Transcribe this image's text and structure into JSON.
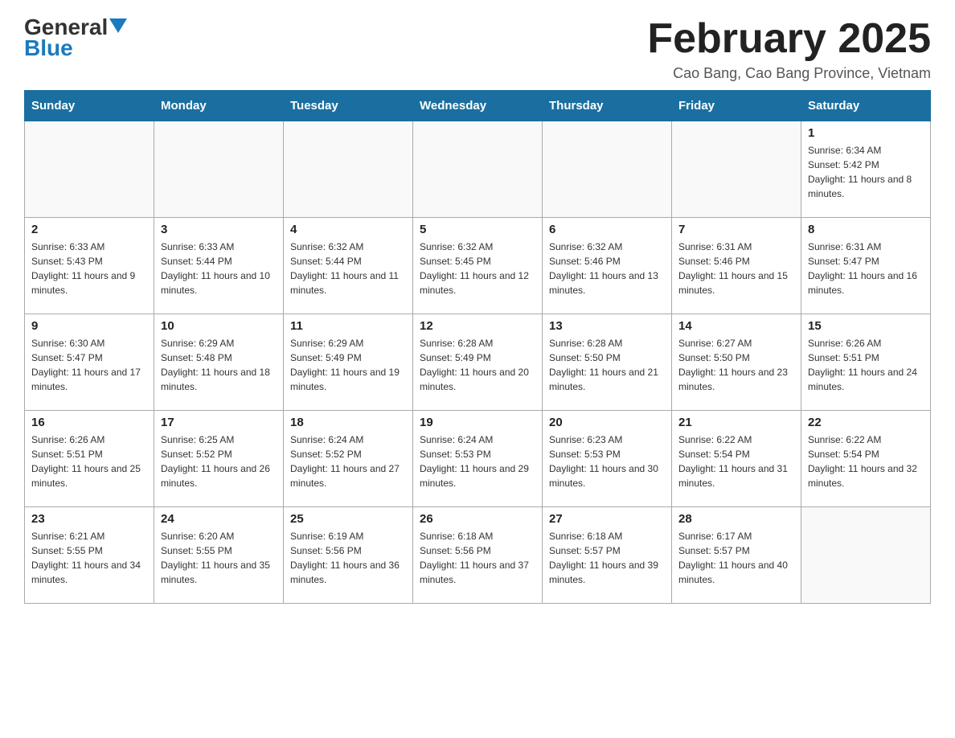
{
  "header": {
    "logo_main": "General",
    "logo_sub": "Blue",
    "title": "February 2025",
    "subtitle": "Cao Bang, Cao Bang Province, Vietnam"
  },
  "days_of_week": [
    "Sunday",
    "Monday",
    "Tuesday",
    "Wednesday",
    "Thursday",
    "Friday",
    "Saturday"
  ],
  "weeks": [
    [
      {
        "day": "",
        "info": ""
      },
      {
        "day": "",
        "info": ""
      },
      {
        "day": "",
        "info": ""
      },
      {
        "day": "",
        "info": ""
      },
      {
        "day": "",
        "info": ""
      },
      {
        "day": "",
        "info": ""
      },
      {
        "day": "1",
        "info": "Sunrise: 6:34 AM\nSunset: 5:42 PM\nDaylight: 11 hours and 8 minutes."
      }
    ],
    [
      {
        "day": "2",
        "info": "Sunrise: 6:33 AM\nSunset: 5:43 PM\nDaylight: 11 hours and 9 minutes."
      },
      {
        "day": "3",
        "info": "Sunrise: 6:33 AM\nSunset: 5:44 PM\nDaylight: 11 hours and 10 minutes."
      },
      {
        "day": "4",
        "info": "Sunrise: 6:32 AM\nSunset: 5:44 PM\nDaylight: 11 hours and 11 minutes."
      },
      {
        "day": "5",
        "info": "Sunrise: 6:32 AM\nSunset: 5:45 PM\nDaylight: 11 hours and 12 minutes."
      },
      {
        "day": "6",
        "info": "Sunrise: 6:32 AM\nSunset: 5:46 PM\nDaylight: 11 hours and 13 minutes."
      },
      {
        "day": "7",
        "info": "Sunrise: 6:31 AM\nSunset: 5:46 PM\nDaylight: 11 hours and 15 minutes."
      },
      {
        "day": "8",
        "info": "Sunrise: 6:31 AM\nSunset: 5:47 PM\nDaylight: 11 hours and 16 minutes."
      }
    ],
    [
      {
        "day": "9",
        "info": "Sunrise: 6:30 AM\nSunset: 5:47 PM\nDaylight: 11 hours and 17 minutes."
      },
      {
        "day": "10",
        "info": "Sunrise: 6:29 AM\nSunset: 5:48 PM\nDaylight: 11 hours and 18 minutes."
      },
      {
        "day": "11",
        "info": "Sunrise: 6:29 AM\nSunset: 5:49 PM\nDaylight: 11 hours and 19 minutes."
      },
      {
        "day": "12",
        "info": "Sunrise: 6:28 AM\nSunset: 5:49 PM\nDaylight: 11 hours and 20 minutes."
      },
      {
        "day": "13",
        "info": "Sunrise: 6:28 AM\nSunset: 5:50 PM\nDaylight: 11 hours and 21 minutes."
      },
      {
        "day": "14",
        "info": "Sunrise: 6:27 AM\nSunset: 5:50 PM\nDaylight: 11 hours and 23 minutes."
      },
      {
        "day": "15",
        "info": "Sunrise: 6:26 AM\nSunset: 5:51 PM\nDaylight: 11 hours and 24 minutes."
      }
    ],
    [
      {
        "day": "16",
        "info": "Sunrise: 6:26 AM\nSunset: 5:51 PM\nDaylight: 11 hours and 25 minutes."
      },
      {
        "day": "17",
        "info": "Sunrise: 6:25 AM\nSunset: 5:52 PM\nDaylight: 11 hours and 26 minutes."
      },
      {
        "day": "18",
        "info": "Sunrise: 6:24 AM\nSunset: 5:52 PM\nDaylight: 11 hours and 27 minutes."
      },
      {
        "day": "19",
        "info": "Sunrise: 6:24 AM\nSunset: 5:53 PM\nDaylight: 11 hours and 29 minutes."
      },
      {
        "day": "20",
        "info": "Sunrise: 6:23 AM\nSunset: 5:53 PM\nDaylight: 11 hours and 30 minutes."
      },
      {
        "day": "21",
        "info": "Sunrise: 6:22 AM\nSunset: 5:54 PM\nDaylight: 11 hours and 31 minutes."
      },
      {
        "day": "22",
        "info": "Sunrise: 6:22 AM\nSunset: 5:54 PM\nDaylight: 11 hours and 32 minutes."
      }
    ],
    [
      {
        "day": "23",
        "info": "Sunrise: 6:21 AM\nSunset: 5:55 PM\nDaylight: 11 hours and 34 minutes."
      },
      {
        "day": "24",
        "info": "Sunrise: 6:20 AM\nSunset: 5:55 PM\nDaylight: 11 hours and 35 minutes."
      },
      {
        "day": "25",
        "info": "Sunrise: 6:19 AM\nSunset: 5:56 PM\nDaylight: 11 hours and 36 minutes."
      },
      {
        "day": "26",
        "info": "Sunrise: 6:18 AM\nSunset: 5:56 PM\nDaylight: 11 hours and 37 minutes."
      },
      {
        "day": "27",
        "info": "Sunrise: 6:18 AM\nSunset: 5:57 PM\nDaylight: 11 hours and 39 minutes."
      },
      {
        "day": "28",
        "info": "Sunrise: 6:17 AM\nSunset: 5:57 PM\nDaylight: 11 hours and 40 minutes."
      },
      {
        "day": "",
        "info": ""
      }
    ]
  ]
}
